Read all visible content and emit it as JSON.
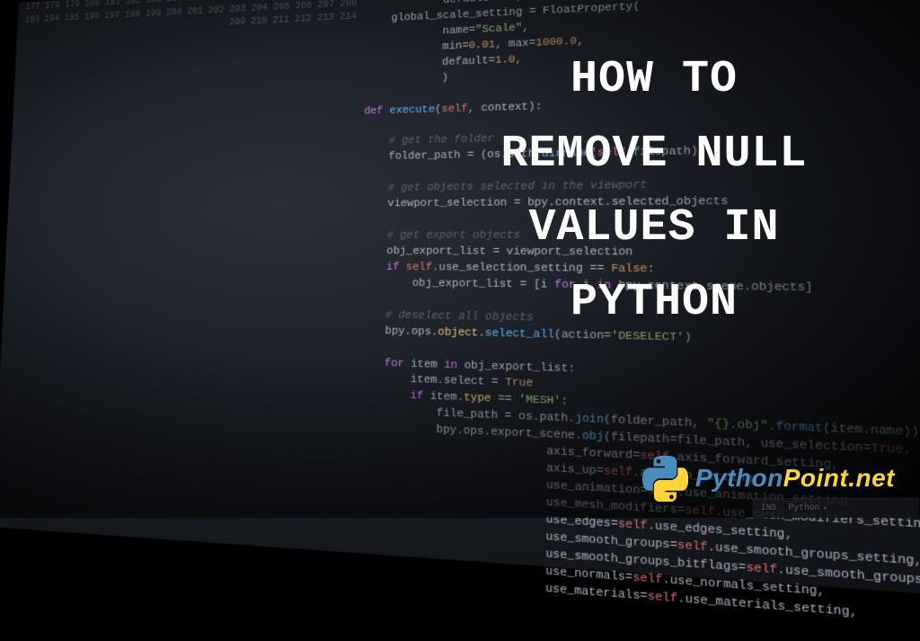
{
  "title_lines": [
    "HOW TO",
    "REMOVE NULL",
    "VALUES IN",
    "PYTHON"
  ],
  "brand": {
    "part1": "Python",
    "part2": "Point.net"
  },
  "statusbar": {
    "mode": "INS",
    "lang": "Python"
  },
  "gutter_start": 177,
  "code_lines": [
    {
      "n": 177,
      "html": "            ),"
    },
    {
      "n": 178,
      "html": "            default=<span class='str'>'Y'</span>,"
    },
    {
      "n": 179,
      "html": "    global_scale_setting = FloatProperty("
    },
    {
      "n": 180,
      "html": "            name=<span class='str'>\"Scale\"</span>,"
    },
    {
      "n": 181,
      "html": "            min=<span class='num'>0.01</span>, max=<span class='num'>1000.0</span>,"
    },
    {
      "n": 182,
      "html": "            default=<span class='num'>1.0</span>,"
    },
    {
      "n": 183,
      "html": "            )"
    },
    {
      "n": 184,
      "html": ""
    },
    {
      "n": 185,
      "html": "<span class='kw'>def</span> <span class='fn'>execute</span>(<span class='self'>self</span>, context):"
    },
    {
      "n": 186,
      "html": ""
    },
    {
      "n": 187,
      "html": "    <span class='cm'># get the folder</span>"
    },
    {
      "n": 188,
      "html": "    folder_path = (os.path.<span class='fn'>dirname</span>(<span class='self'>self</span>.filepath))"
    },
    {
      "n": 189,
      "html": ""
    },
    {
      "n": 190,
      "html": "    <span class='cm'># get objects selected in the viewport</span>"
    },
    {
      "n": 191,
      "html": "    viewport_selection = bpy.context.selected_objects"
    },
    {
      "n": 192,
      "html": ""
    },
    {
      "n": 193,
      "html": "    <span class='cm'># get export objects</span>"
    },
    {
      "n": 194,
      "html": "    obj_export_list = viewport_selection"
    },
    {
      "n": 195,
      "html": "    <span class='kw'>if</span> <span class='self'>self</span>.use_selection_setting == <span class='bool'>False</span>:"
    },
    {
      "n": 196,
      "html": "        obj_export_list = [i <span class='kw'>for</span> i <span class='kw'>in</span> bpy.context.scene.objects]"
    },
    {
      "n": 197,
      "html": ""
    },
    {
      "n": 198,
      "html": "    <span class='cm'># deselect all objects</span>"
    },
    {
      "n": 199,
      "html": "    bpy.ops.<span class='prop'>object</span>.<span class='fn'>select_all</span>(action=<span class='str'>'DESELECT'</span>)"
    },
    {
      "n": 200,
      "html": ""
    },
    {
      "n": 201,
      "html": "    <span class='kw'>for</span> item <span class='kw'>in</span> obj_export_list:"
    },
    {
      "n": 202,
      "html": "        item.select = <span class='bool'>True</span>"
    },
    {
      "n": 203,
      "html": "        <span class='kw'>if</span> item.<span class='prop'>type</span> == <span class='str'>'MESH'</span>:"
    },
    {
      "n": 204,
      "html": "            file_path = os.path.<span class='fn'>join</span>(folder_path, <span class='str'>\"{}.obj\"</span>.<span class='fn'>format</span>(item.name))"
    },
    {
      "n": 205,
      "html": "            bpy.ops.export_scene.<span class='fn'>obj</span>(filepath=file_path, use_selection=<span class='bool'>True</span>,"
    },
    {
      "n": 206,
      "html": "                            axis_forward=<span class='self'>self</span>.axis_forward_setting,"
    },
    {
      "n": 207,
      "html": "                            axis_up=<span class='self'>self</span>.axis_up_setting,"
    },
    {
      "n": 208,
      "html": "                            use_animation=<span class='self'>self</span>.use_animation_setting,"
    },
    {
      "n": 209,
      "html": "                            use_mesh_modifiers=<span class='self'>self</span>.use_mesh_modifiers_setting,"
    },
    {
      "n": 210,
      "html": "                            use_edges=<span class='self'>self</span>.use_edges_setting,"
    },
    {
      "n": 211,
      "html": "                            use_smooth_groups=<span class='self'>self</span>.use_smooth_groups_setting,"
    },
    {
      "n": 212,
      "html": "                            use_smooth_groups_bitflags=<span class='self'>self</span>.use_smooth_groups_bitflags_setting,"
    },
    {
      "n": 213,
      "html": "                            use_normals=<span class='self'>self</span>.use_normals_setting,"
    },
    {
      "n": 214,
      "html": "                            use_materials=<span class='self'>self</span>.use_materials_setting,"
    }
  ]
}
